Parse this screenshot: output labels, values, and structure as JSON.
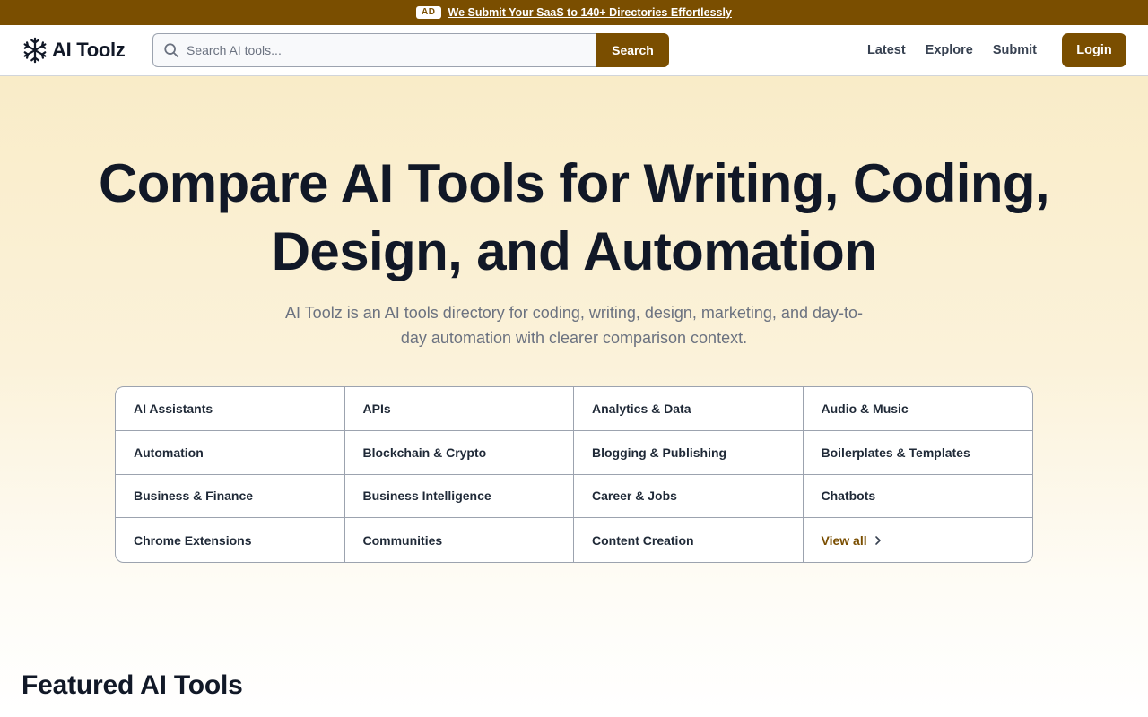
{
  "ad_banner": {
    "badge": "AD",
    "text": "We Submit Your SaaS to 140+ Directories Effortlessly"
  },
  "header": {
    "logo_text": "AI Toolz",
    "search": {
      "placeholder": "Search AI tools...",
      "value": "",
      "button_label": "Search"
    },
    "nav": {
      "latest": "Latest",
      "explore": "Explore",
      "submit": "Submit",
      "login": "Login"
    }
  },
  "hero": {
    "title": "Compare AI Tools for Writing, Coding, Design, and Automation",
    "subtitle": "AI Toolz is an AI tools directory for coding, writing, design, marketing, and day-to-day automation with clearer comparison context."
  },
  "categories": {
    "items": [
      "AI Assistants",
      "APIs",
      "Analytics & Data",
      "Audio & Music",
      "Automation",
      "Blockchain & Crypto",
      "Blogging & Publishing",
      "Boilerplates & Templates",
      "Business & Finance",
      "Business Intelligence",
      "Career & Jobs",
      "Chatbots",
      "Chrome Extensions",
      "Communities",
      "Content Creation"
    ],
    "view_all": "View all"
  },
  "featured": {
    "title": "Featured AI Tools"
  },
  "colors": {
    "brand": "#7a4e00",
    "hero_top": "#f9ecc8",
    "text_dark": "#111827",
    "text_muted": "#6b7280"
  },
  "icons": {
    "logo": "snowflake-icon",
    "search": "search-icon",
    "view_all": "chevron-right-icon"
  }
}
